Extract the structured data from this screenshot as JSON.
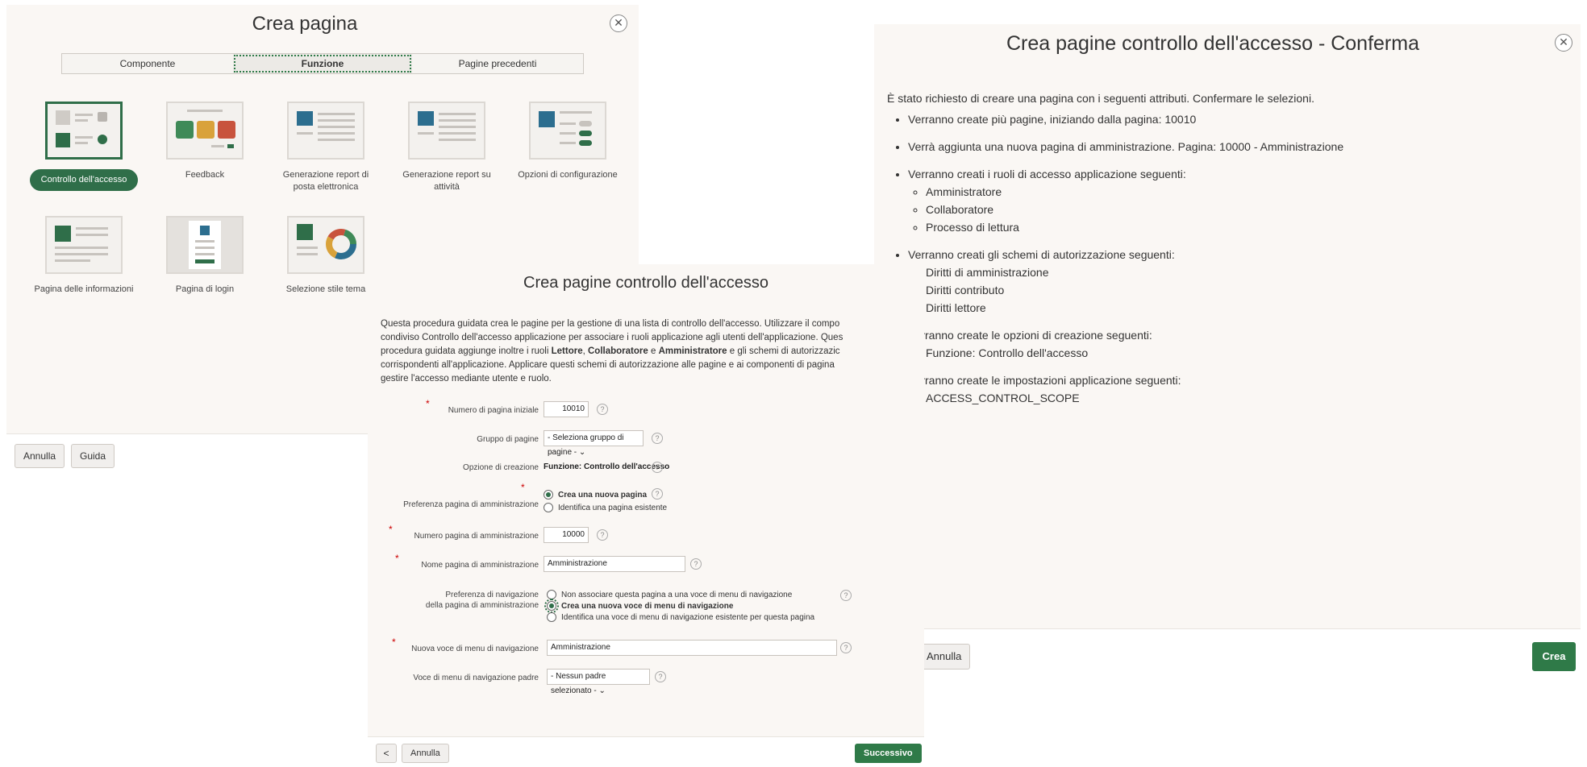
{
  "create_page": {
    "title": "Crea pagina",
    "close_symbol": "✕",
    "tabs": [
      "Componente",
      "Funzione",
      "Pagine precedenti"
    ],
    "active_tab": "Funzione",
    "tiles": [
      {
        "label": "Controllo dell'accesso",
        "icon": "access-control-icon",
        "selected": true
      },
      {
        "label": "Feedback",
        "icon": "feedback-icon"
      },
      {
        "label": "Generazione report di posta elettronica",
        "icon": "email-reporting-icon"
      },
      {
        "label": "Generazione report su attività",
        "icon": "activity-reporting-icon"
      },
      {
        "label": "Opzioni di configurazione",
        "icon": "configuration-options-icon"
      },
      {
        "label": "Pagina delle informazioni",
        "icon": "about-page-icon"
      },
      {
        "label": "Pagina di login",
        "icon": "login-page-icon"
      },
      {
        "label": "Selezione stile tema",
        "icon": "theme-style-icon"
      }
    ],
    "footer": {
      "cancel": "Annulla",
      "help": "Guida"
    }
  },
  "access_wizard": {
    "title": "Crea pagine controllo dell'accesso",
    "intro_lines": [
      [
        "Questa procedura guidata crea le pagine per la gestione di una lista di controllo dell'accesso. Utilizzare il compo"
      ],
      [
        "condiviso Controllo dell'accesso applicazione per associare i ruoli applicazione agli utenti dell'applicazione. Ques"
      ],
      [
        "procedura guidata aggiunge inoltre i ruoli ",
        "Lettore",
        ", ",
        "Collaboratore",
        " e ",
        "Amministratore",
        " e gli schemi di autorizzazic"
      ],
      [
        "corrispondenti all'applicazione. Applicare questi schemi di autorizzazione alle pagine e ai componenti di pagina"
      ],
      [
        "gestire l'accesso mediante utente e ruolo."
      ]
    ],
    "fields": {
      "start_page": {
        "label": "Numero di pagina iniziale",
        "value": "10010"
      },
      "page_group": {
        "label": "Gruppo di pagine",
        "value": "- Seleziona gruppo di pagine -"
      },
      "create_option": {
        "label": "Opzione di creazione",
        "value": "Funzione: Controllo dell'accesso"
      },
      "admin_pref": {
        "label": "Preferenza pagina di amministrazione",
        "options": [
          "Crea una nuova pagina",
          "Identifica una pagina esistente"
        ],
        "selected": 0
      },
      "admin_page_number": {
        "label": "Numero pagina di amministrazione",
        "value": "10000"
      },
      "admin_page_name": {
        "label": "Nome pagina di amministrazione",
        "value": "Amministrazione"
      },
      "nav_pref": {
        "label_line1": "Preferenza di navigazione",
        "label_line2": "della pagina di amministrazione",
        "options": [
          "Non associare questa pagina a una voce di menu di navigazione",
          "Crea una nuova voce di menu di navigazione",
          "Identifica una voce di menu di navigazione esistente per questa pagina"
        ],
        "selected": 1
      },
      "new_nav_entry": {
        "label": "Nuova voce di menu di navigazione",
        "value": "Amministrazione"
      },
      "parent_nav_entry": {
        "label": "Voce di menu di navigazione padre",
        "value": "- Nessun padre selezionato -"
      }
    },
    "help_symbol": "?",
    "required_symbol": "*",
    "footer": {
      "back": "<",
      "cancel": "Annulla",
      "next": "Successivo"
    }
  },
  "confirm": {
    "title": "Crea pagine controllo dell'accesso - Conferma",
    "intro": "È stato richiesto di creare una pagina con i seguenti attributi. Confermare le selezioni.",
    "items": [
      {
        "text": "Verranno create più pagine, iniziando dalla pagina: 10010",
        "sub": []
      },
      {
        "text": "Verrà aggiunta una nuova pagina di amministrazione. Pagina: 10000 - Amministrazione",
        "sub": []
      },
      {
        "text": "Verranno creati i ruoli di accesso applicazione seguenti:",
        "sub": [
          "Amministratore",
          "Collaboratore",
          "Processo di lettura"
        ]
      },
      {
        "text": "Verranno creati gli schemi di autorizzazione seguenti:",
        "sub": [
          "Diritti di amministrazione",
          "Diritti contributo",
          "Diritti lettore"
        ]
      },
      {
        "text": "Verranno create le opzioni di creazione seguenti:",
        "sub": [
          "Funzione: Controllo dell'accesso"
        ]
      },
      {
        "text": "Verranno create le impostazioni applicazione seguenti:",
        "sub": [
          "ACCESS_CONTROL_SCOPE"
        ]
      }
    ],
    "footer": {
      "back": "<",
      "cancel": "Annulla",
      "create": "Crea"
    }
  },
  "colors": {
    "accent_green": "#2f6e49",
    "panel_bg": "#faf7f4",
    "required_red": "#cc0000"
  }
}
